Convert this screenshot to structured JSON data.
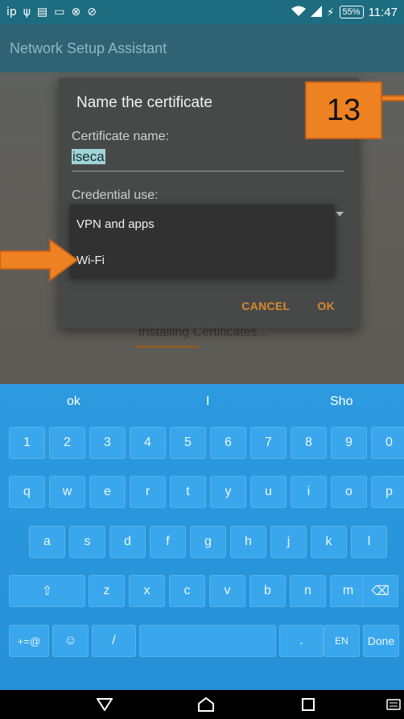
{
  "status_bar": {
    "left_icons": [
      "ip",
      "usb-icon",
      "doc-icon",
      "image-icon",
      "sync-icon",
      "blocked-icon"
    ],
    "battery": "55%",
    "time": "11:47"
  },
  "app": {
    "title": "Network Setup Assistant"
  },
  "background": {
    "installing_text": "Installing Certificates..."
  },
  "dialog": {
    "title": "Name the certificate",
    "certificate_name_label": "Certificate name:",
    "certificate_name_value": "iseca",
    "credential_use_label": "Credential use:",
    "cancel_label": "CANCEL",
    "ok_label": "OK"
  },
  "spinner": {
    "options": [
      "VPN and apps",
      "Wi-Fi"
    ]
  },
  "callout": {
    "number": "13"
  },
  "keyboard": {
    "suggestions": [
      "ok",
      "I",
      "Sho"
    ],
    "row_numbers": [
      "1",
      "2",
      "3",
      "4",
      "5",
      "6",
      "7",
      "8",
      "9",
      "0"
    ],
    "row1": [
      "q",
      "w",
      "e",
      "r",
      "t",
      "y",
      "u",
      "i",
      "o",
      "p"
    ],
    "row2": [
      "a",
      "s",
      "d",
      "f",
      "g",
      "h",
      "j",
      "k",
      "l"
    ],
    "row3": [
      "z",
      "x",
      "c",
      "v",
      "b",
      "n",
      "m"
    ],
    "symbols_key": "+=@",
    "punct_key": ".",
    "punct_hint": "?!",
    "lang_key": "EN",
    "done_key": "Done"
  },
  "colors": {
    "accent": "#d7892f",
    "callout": "#ee8122",
    "keyboard": "#2d9ae0",
    "status_bar": "#1d6c7f"
  }
}
